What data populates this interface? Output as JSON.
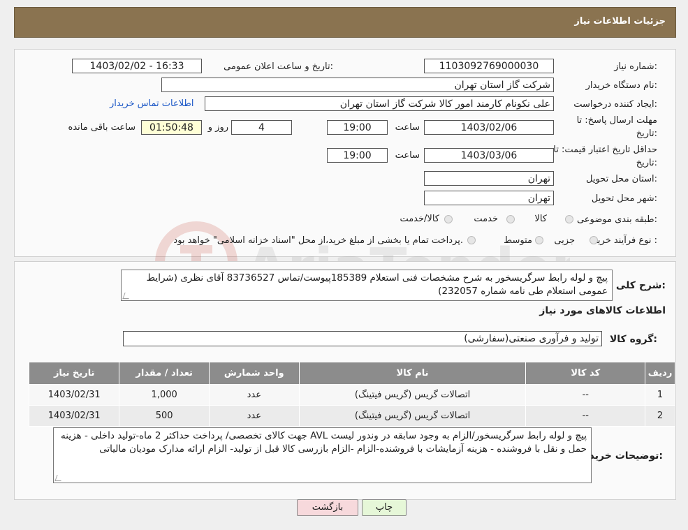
{
  "header": {
    "title": "جزئیات اطلاعات نیاز"
  },
  "labels": {
    "need_number": "شماره نیاز:",
    "announce_datetime": "تاریخ و ساعت اعلان عمومی:",
    "buyer_org": "نام دستگاه خریدار:",
    "requester": "ایجاد کننده درخواست:",
    "deadline": "مهلت ارسال پاسخ: تا",
    "deadline2": "تاریخ:",
    "time": "ساعت",
    "days": "روز و",
    "remaining": "ساعت باقی مانده",
    "price_validity": "حداقل تاریخ اعتبار قیمت: تا",
    "price_validity2": "تاریخ:",
    "time2": "ساعت",
    "province": "استان محل تحویل:",
    "city": "شهر محل تحویل:",
    "category": "طبقه بندی موضوعی:",
    "process": "نوع فرآیند خرید :"
  },
  "values": {
    "need_number": "1103092769000030",
    "announce_datetime": "1403/02/02 - 16:33",
    "buyer_org": "شرکت گاز استان تهران",
    "requester": "علی نکونام کارمند امور کالا شرکت گاز استان تهران",
    "contact_link": "اطلاعات تماس خریدار",
    "deadline_date": "1403/02/06",
    "deadline_time": "19:00",
    "days": "4",
    "remaining_time": "01:50:48",
    "validity_date": "1403/03/06",
    "validity_time": "19:00",
    "province": "تهران",
    "city": "تهران"
  },
  "category_options": [
    "کالا",
    "خدمت",
    "کالا/خدمت"
  ],
  "process_options": [
    "جزیی",
    "متوسط"
  ],
  "process_note": "پرداخت تمام یا بخشی از مبلغ خرید،از محل \"اسناد خزانه اسلامی\" خواهد بود.",
  "description": {
    "label": "شرح کلی نیاز:",
    "text": "پیچ و لوله رابط سرگریسخور به شرح مشخصات فنی استعلام 185389پیوست/تماس 83736527 آقای نظری (شرایط عمومی استعلام طی نامه شماره 232057)"
  },
  "goods_section_title": "اطلاعات کالاهای مورد نیاز",
  "goods_group": {
    "label": "گروه کالا:",
    "value": "تولید و فرآوری صنعتی(سفارشی)"
  },
  "table": {
    "headers": [
      "ردیف",
      "کد کالا",
      "نام کالا",
      "واحد شمارش",
      "تعداد / مقدار",
      "تاریخ نیاز"
    ],
    "rows": [
      [
        "1",
        "--",
        "اتصالات گریس (گریس فیتینگ)",
        "عدد",
        "1,000",
        "1403/02/31"
      ],
      [
        "2",
        "--",
        "اتصالات گریس (گریس فیتینگ)",
        "عدد",
        "500",
        "1403/02/31"
      ]
    ]
  },
  "buyer_notes": {
    "label": "توضیحات خریدار:",
    "text": "پیچ و لوله رابط سرگریسخور/الزام به وجود سابقه در وندور لیست AVL جهت کالای تخصصی/ پرداخت حداکثر 2 ماه-تولید داخلی - هزینه حمل و نقل با فروشنده - هزینه آزمایشات با فروشنده-الزام  -الزام بازرسی کالا قبل از تولید- الزام ارائه مدارک مودیان مالیاتی"
  },
  "buttons": {
    "print": "چاپ",
    "back": "بازگشت"
  },
  "watermark": "AriaTender.neT",
  "colors": {
    "header": "#8a7350",
    "link": "#1a56c6",
    "print_btn": "#e6f7d8",
    "back_btn": "#f7d9dc",
    "table_header": "#8c8c8c"
  }
}
